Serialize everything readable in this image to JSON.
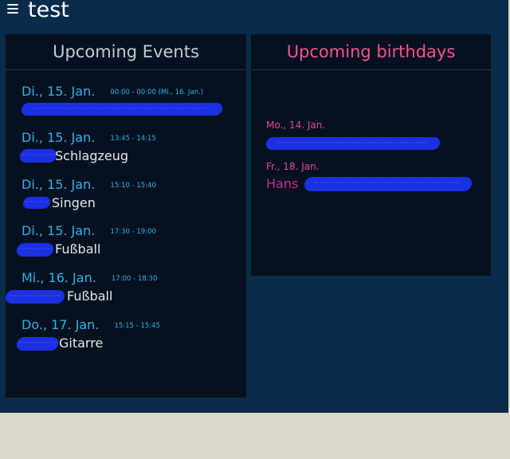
{
  "app": {
    "title": "test"
  },
  "events_panel": {
    "heading": "Upcoming Events",
    "events": [
      {
        "date": "Di., 15. Jan.",
        "time": "00:00 - 00:00  (Mi., 16. Jan.)",
        "title": ""
      },
      {
        "date": "Di., 15. Jan.",
        "time": "13:45 - 14:15",
        "title": "Schlagzeug"
      },
      {
        "date": "Di., 15. Jan.",
        "time": "15:10 - 15:40",
        "title": "Singen"
      },
      {
        "date": "Di., 15. Jan.",
        "time": "17:30 - 19:00",
        "title": "Fußball"
      },
      {
        "date": "Mi., 16. Jan.",
        "time": "17:00 - 18:30",
        "title": "Fußball"
      },
      {
        "date": "Do., 17. Jan.",
        "time": "15:15 - 15:45",
        "title": "Gitarre"
      }
    ]
  },
  "birthdays_panel": {
    "heading": "Upcoming birthdays",
    "birthdays": [
      {
        "date": "Mo., 14. Jan.",
        "name": ""
      },
      {
        "date": "Fr., 18. Jan.",
        "name": "Hans"
      }
    ]
  },
  "colors": {
    "background": "#0b2b4a",
    "panel": "#06111f",
    "event_accent": "#2fb2ea",
    "birthday_accent": "#ef5592",
    "redaction": "#1b2fe3"
  }
}
